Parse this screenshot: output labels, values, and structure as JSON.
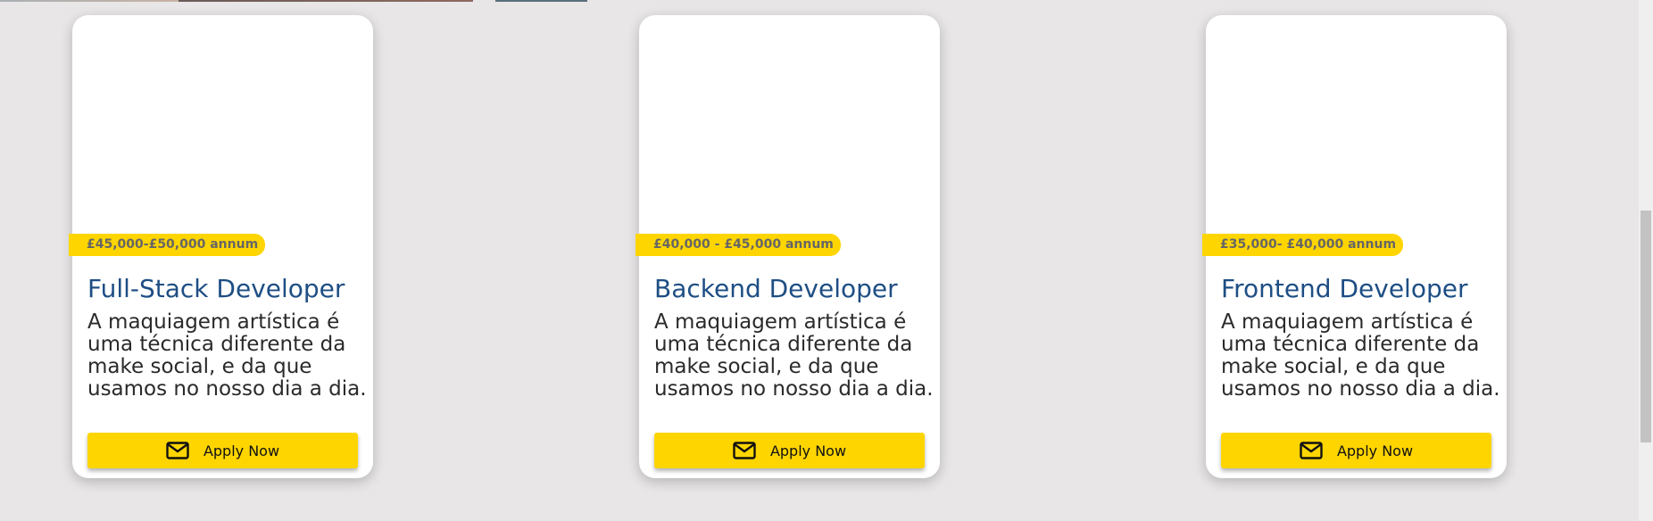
{
  "colors": {
    "page_background": "#e8e6e7",
    "card_background": "#ffffff",
    "accent_yellow": "#ffd500",
    "title_blue": "#1e4e84",
    "badge_text": "#666666"
  },
  "jobs": [
    {
      "salary": "£45,000-£50,000 annum",
      "title": "Full-Stack Developer",
      "description": "A maquiagem artística é uma técnica diferente da make social, e da que usamos no nosso dia a dia.",
      "apply_label": "Apply Now",
      "apply_icon": "mail-icon"
    },
    {
      "salary": "£40,000 - £45,000 annum",
      "title": "Backend Developer",
      "description": "A maquiagem artística é uma técnica diferente da make social, e da que usamos no nosso dia a dia.",
      "apply_label": "Apply Now",
      "apply_icon": "mail-icon"
    },
    {
      "salary": "£35,000- £40,000 annum",
      "title": "Frontend Developer",
      "description": "A maquiagem artística é uma técnica diferente da make social, e da que usamos no nosso dia a dia.",
      "apply_label": "Apply Now",
      "apply_icon": "mail-icon"
    }
  ]
}
